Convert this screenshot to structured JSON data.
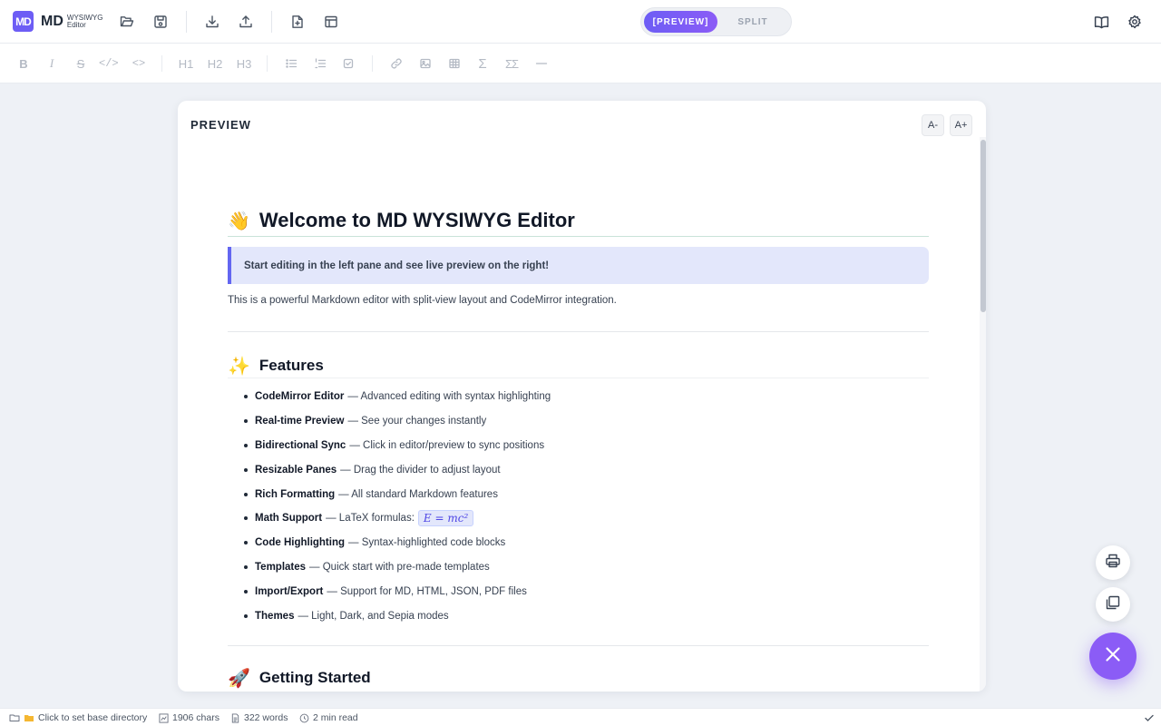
{
  "app": {
    "logo_mark": "MD",
    "logo_name": "MD",
    "logo_line1": "WYSIWYG",
    "logo_line2": "Editor"
  },
  "toolbar": {
    "icons": [
      "folder-open-icon",
      "save-icon",
      "download-icon",
      "upload-icon",
      "new-file-icon",
      "template-icon"
    ],
    "right_icons": [
      "book-icon",
      "gear-icon"
    ]
  },
  "view_mode": {
    "options": [
      "[PREVIEW]",
      "SPLIT"
    ],
    "active": "[PREVIEW]"
  },
  "format_bar": {
    "buttons": [
      "B",
      "I",
      "S",
      "</>",
      "<>",
      "H1",
      "H2",
      "H3"
    ],
    "icons": [
      "bullet-list-icon",
      "numbered-list-icon",
      "task-list-icon",
      "link-icon",
      "image-icon",
      "table-icon",
      "sigma-icon",
      "double-sigma-icon",
      "horizontal-rule-icon"
    ]
  },
  "preview": {
    "title": "PREVIEW",
    "zoom_out": "A-",
    "zoom_in": "A+"
  },
  "document": {
    "h1_emoji": "👋",
    "h1": "Welcome to MD WYSIWYG Editor",
    "callout": "Start editing in the left pane and see live preview on the right!",
    "intro": "This is a powerful Markdown editor with split-view layout and CodeMirror integration.",
    "features_emoji": "✨",
    "features_title": "Features",
    "features": [
      {
        "name": "CodeMirror Editor",
        "desc": "— Advanced editing with syntax highlighting"
      },
      {
        "name": "Real-time Preview",
        "desc": "— See your changes instantly"
      },
      {
        "name": "Bidirectional Sync",
        "desc": "— Click in editor/preview to sync positions"
      },
      {
        "name": "Resizable Panes",
        "desc": "— Drag the divider to adjust layout"
      },
      {
        "name": "Rich Formatting",
        "desc": "— All standard Markdown features"
      },
      {
        "name": "Math Support",
        "desc": "— LaTeX formulas:",
        "math": "E = mc²"
      },
      {
        "name": "Code Highlighting",
        "desc": "— Syntax-highlighted code blocks"
      },
      {
        "name": "Templates",
        "desc": "— Quick start with pre-made templates"
      },
      {
        "name": "Import/Export",
        "desc": "— Support for MD, HTML, JSON, PDF files"
      },
      {
        "name": "Themes",
        "desc": "— Light, Dark, and Sepia modes"
      }
    ],
    "getting_started_emoji": "🚀",
    "getting_started_title": "Getting Started"
  },
  "floating": {
    "icons": [
      "printer-icon",
      "copy-icon",
      "close-icon"
    ]
  },
  "status": {
    "base_dir": "Click to set base directory",
    "chars": "1906 chars",
    "words": "322 words",
    "read_time": "2 min read"
  },
  "colors": {
    "accent": "#8b5cf6",
    "callout_bg": "#e3e7fb",
    "callout_border": "#6366f1"
  }
}
